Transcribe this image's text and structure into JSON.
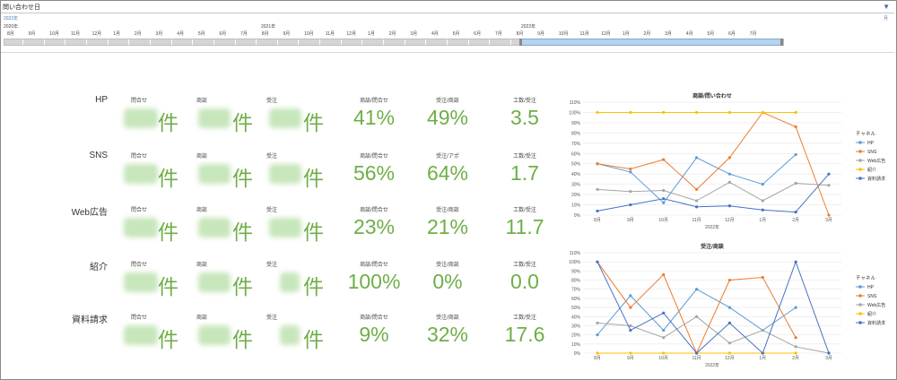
{
  "header": {
    "title": "問い合わせ日"
  },
  "timeline": {
    "selected_label": "2022年",
    "right_label": "月",
    "years": [
      "2020年",
      "2021年",
      "2022年"
    ],
    "months": [
      "8月",
      "9月",
      "10月",
      "11月",
      "12月",
      "1月",
      "2月",
      "3月",
      "4月",
      "5月",
      "6月",
      "7月",
      "8月",
      "9月",
      "10月",
      "11月",
      "12月",
      "1月",
      "2月",
      "3月",
      "4月",
      "5月",
      "6月",
      "7月",
      "8月",
      "9月",
      "10月",
      "11月",
      "12月",
      "1月",
      "2月",
      "3月",
      "4月",
      "5月",
      "6月",
      "7月"
    ],
    "selection": "2021年8月〜2022年7月"
  },
  "kpi": {
    "rows": [
      {
        "label": "HP",
        "heads": [
          "問合せ",
          "商談",
          "受注",
          "商談/問合せ",
          "受注/商談",
          "工数/受注"
        ],
        "unit": "件",
        "values": [
          "41%",
          "49%",
          "3.5"
        ]
      },
      {
        "label": "SNS",
        "heads": [
          "問合せ",
          "商談",
          "受注",
          "商談/問合せ",
          "受注/アポ",
          "工数/受注"
        ],
        "unit": "件",
        "values": [
          "56%",
          "64%",
          "1.7"
        ]
      },
      {
        "label": "Web広告",
        "heads": [
          "問合せ",
          "商談",
          "受注",
          "商談/問合せ",
          "受注/商談",
          "工数/受注"
        ],
        "unit": "件",
        "values": [
          "23%",
          "21%",
          "11.7"
        ]
      },
      {
        "label": "紹介",
        "heads": [
          "問合せ",
          "商談",
          "受注",
          "商談/問合せ",
          "受注/商談",
          "工数/受注"
        ],
        "unit": "件",
        "values": [
          "100%",
          "0%",
          "0.0"
        ]
      },
      {
        "label": "資料請求",
        "heads": [
          "問合せ",
          "商談",
          "受注",
          "商談/問合せ",
          "受注/商談",
          "工数/受注"
        ],
        "unit": "件",
        "values": [
          "9%",
          "32%",
          "17.6"
        ]
      }
    ]
  },
  "colors": {
    "kpi_green": "#6fae47",
    "HP": "#5b9bd5",
    "SNS": "#ed7d31",
    "Web広告": "#a5a5a5",
    "紹介": "#ffc000",
    "資料請求": "#4472c4"
  },
  "chart_data": [
    {
      "type": "line",
      "title": "商談/問い合わせ",
      "xlabel": "2022年",
      "ylabel": "",
      "categories": [
        "8月",
        "9月",
        "10月",
        "11月",
        "12月",
        "1月",
        "2月",
        "3月"
      ],
      "ylim": [
        0,
        110
      ],
      "yticks": [
        "0%",
        "10%",
        "20%",
        "30%",
        "40%",
        "50%",
        "60%",
        "70%",
        "80%",
        "90%",
        "100%",
        "110%"
      ],
      "legend_title": "チャネル",
      "legend_position": "right",
      "series": [
        {
          "name": "HP",
          "values": [
            50,
            42,
            12,
            56,
            40,
            30,
            59,
            null
          ]
        },
        {
          "name": "SNS",
          "values": [
            50,
            45,
            54,
            25,
            56,
            100,
            86,
            0
          ]
        },
        {
          "name": "Web広告",
          "values": [
            25,
            23,
            24,
            14,
            32,
            14,
            31,
            29
          ]
        },
        {
          "name": "紹介",
          "values": [
            100,
            100,
            100,
            100,
            100,
            100,
            100,
            null
          ]
        },
        {
          "name": "資料請求",
          "values": [
            4,
            10,
            16,
            8,
            9,
            5,
            3,
            40
          ]
        }
      ]
    },
    {
      "type": "line",
      "title": "受注/商談",
      "xlabel": "2022年",
      "ylabel": "",
      "categories": [
        "8月",
        "9月",
        "10月",
        "11月",
        "12月",
        "1月",
        "2月",
        "3月"
      ],
      "ylim": [
        0,
        110
      ],
      "yticks": [
        "0%",
        "10%",
        "20%",
        "30%",
        "40%",
        "50%",
        "60%",
        "70%",
        "80%",
        "90%",
        "100%",
        "110%"
      ],
      "legend_title": "チャネル",
      "legend_position": "right",
      "series": [
        {
          "name": "HP",
          "values": [
            20,
            63,
            25,
            70,
            50,
            25,
            50,
            null
          ]
        },
        {
          "name": "SNS",
          "values": [
            100,
            50,
            86,
            0,
            80,
            83,
            17,
            null
          ]
        },
        {
          "name": "Web広告",
          "values": [
            33,
            30,
            17,
            40,
            11,
            25,
            7,
            0
          ]
        },
        {
          "name": "紹介",
          "values": [
            0,
            0,
            0,
            0,
            0,
            0,
            0,
            null
          ]
        },
        {
          "name": "資料請求",
          "values": [
            100,
            25,
            44,
            0,
            33,
            0,
            100,
            0
          ]
        }
      ]
    }
  ]
}
